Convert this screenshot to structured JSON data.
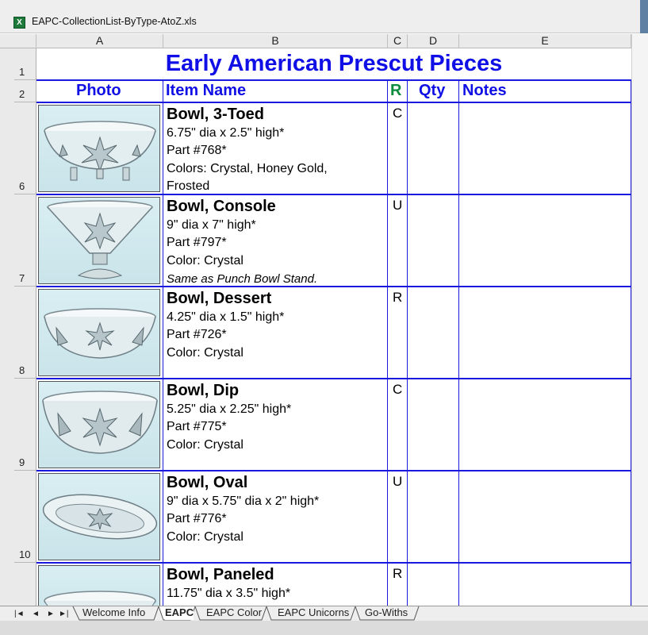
{
  "window": {
    "title": "EAPC-CollectionList-ByType-AtoZ.xls"
  },
  "columns": [
    "A",
    "B",
    "C",
    "D",
    "E"
  ],
  "rows": [
    "1",
    "2",
    "6",
    "7",
    "8",
    "9",
    "10"
  ],
  "sheet": {
    "title": "Early American Prescut Pieces",
    "headers": {
      "photo": "Photo",
      "item_name": "Item Name",
      "rarity": "R",
      "qty": "Qty",
      "notes": "Notes"
    },
    "items": [
      {
        "name": "Bowl, 3-Toed",
        "lines": [
          "6.75\" dia x 2.5\" high*",
          "Part #768*",
          "Colors: Crystal, Honey Gold,",
          "Frosted"
        ],
        "rarity": "C"
      },
      {
        "name": "Bowl, Console",
        "lines": [
          "9\" dia x 7\" high*",
          "Part #797*",
          "Color: Crystal",
          "Same as Punch Bowl Stand."
        ],
        "rarity": "U"
      },
      {
        "name": "Bowl, Dessert",
        "lines": [
          "4.25\" dia x 1.5\" high*",
          "Part #726*",
          "Color: Crystal"
        ],
        "rarity": "R"
      },
      {
        "name": "Bowl, Dip",
        "lines": [
          "5.25\" dia x 2.25\" high*",
          "Part #775*",
          "Color: Crystal"
        ],
        "rarity": "C"
      },
      {
        "name": "Bowl, Oval",
        "lines": [
          "9\" dia x 5.75\" dia x 2\" high*",
          "Part #776*",
          "Color: Crystal"
        ],
        "rarity": "U"
      },
      {
        "name": "Bowl, Paneled",
        "lines": [
          "11.75\" dia x 3.5\" high*"
        ],
        "rarity": "R"
      }
    ]
  },
  "tabs": {
    "nav": [
      "|◄",
      "◄",
      "►",
      "►|"
    ],
    "sheets": [
      "Welcome Info",
      "EAPC",
      "EAPC Color",
      "EAPC Unicorns",
      "Go-Withs"
    ],
    "active": "EAPC"
  },
  "colors": {
    "accent_blue": "#1010e6",
    "grid_blue": "#1a1adf",
    "excel_green": "#1d7a3a"
  },
  "icons": {
    "app": "excel-icon"
  }
}
